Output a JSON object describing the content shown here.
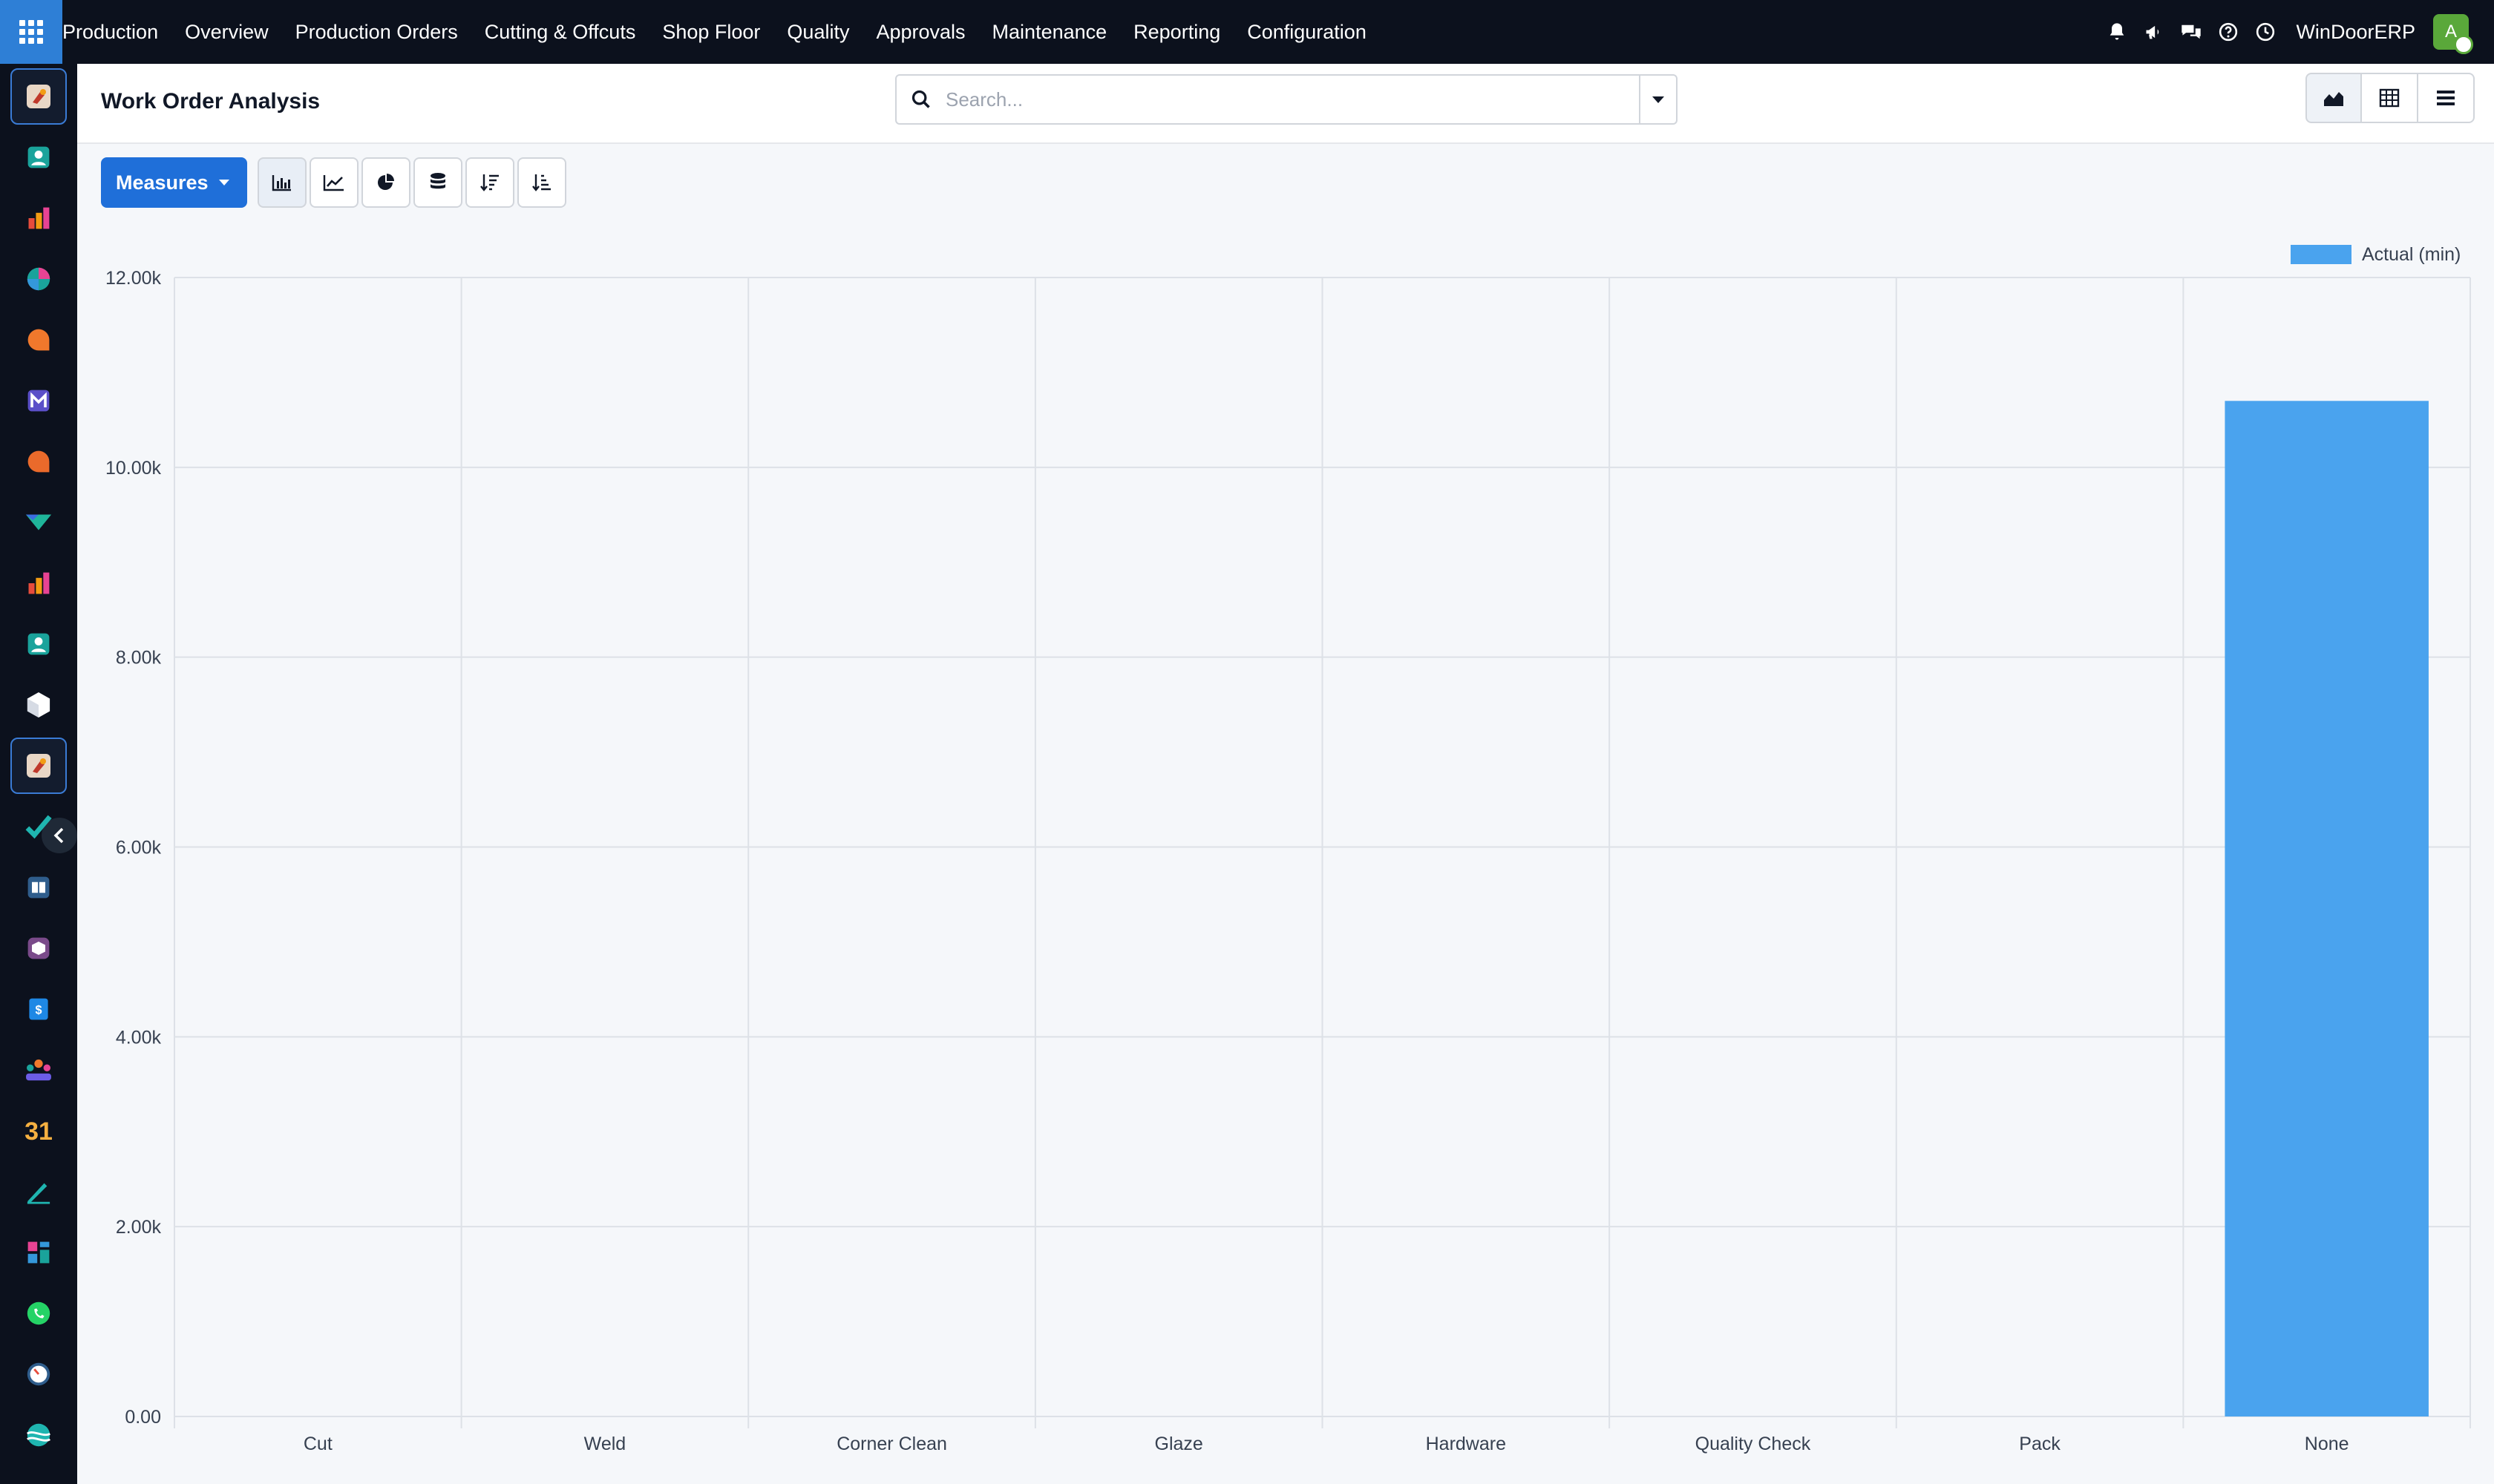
{
  "app": {
    "brand": "Production",
    "company": "WinDoorERP",
    "user_initial": "A"
  },
  "nav": {
    "items": [
      "Overview",
      "Production Orders",
      "Cutting & Offcuts",
      "Shop Floor",
      "Quality",
      "Approvals",
      "Maintenance",
      "Reporting",
      "Configuration"
    ]
  },
  "header": {
    "title": "Work Order Analysis",
    "search_placeholder": "Search..."
  },
  "toolbar": {
    "measures_label": "Measures"
  },
  "colors": {
    "accent": "#1f6fd9",
    "bar": "#4aa3ee",
    "topbar": "#0c111d",
    "avatar": "#5aa83a"
  },
  "chart_data": {
    "type": "bar",
    "categories": [
      "Cut",
      "Weld",
      "Corner Clean",
      "Glaze",
      "Hardware",
      "Quality Check",
      "Pack",
      "None"
    ],
    "series": [
      {
        "name": "Actual (min)",
        "values": [
          0,
          0,
          0,
          0,
          0,
          0,
          0,
          10700
        ]
      }
    ],
    "yticks": [
      "0.00",
      "2.00k",
      "4.00k",
      "6.00k",
      "8.00k",
      "10.00k",
      "12.00k"
    ],
    "ylim": [
      0,
      12000
    ],
    "grid": true,
    "legend": "top-right"
  }
}
